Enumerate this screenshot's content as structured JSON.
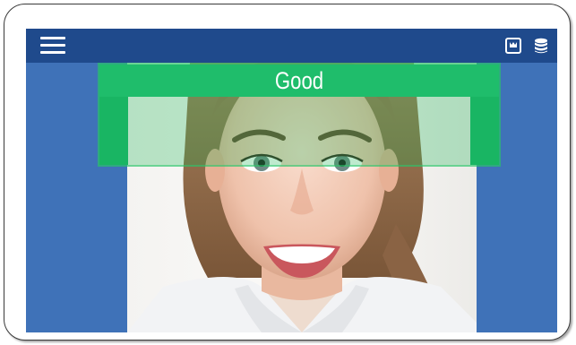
{
  "toolbar": {
    "menu_icon": "hamburger-menu-icon",
    "camera_icon": "camera-icon",
    "database_icon": "database-icon"
  },
  "detection": {
    "status": "Good",
    "status_color": "#19b563"
  },
  "colors": {
    "topbar": "#1f4a8c",
    "background": "#3f72b8",
    "accent": "#19b563"
  }
}
